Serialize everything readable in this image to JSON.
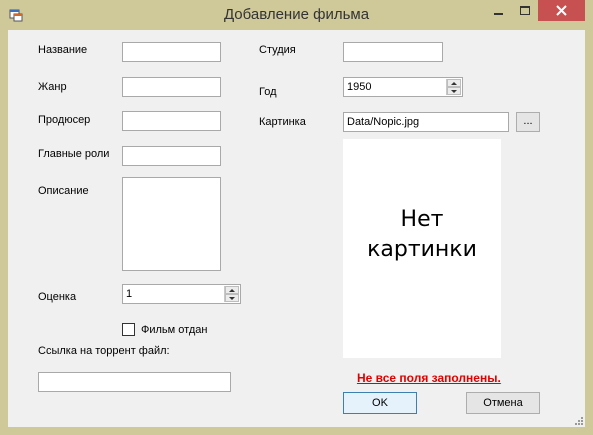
{
  "window": {
    "title": "Добавление фильма",
    "app_icon": "form-icon",
    "controls": [
      "minimize-icon",
      "maximize-icon",
      "close-icon"
    ]
  },
  "labels": {
    "name": "Название",
    "genre": "Жанр",
    "producer": "Продюсер",
    "main_roles": "Главные роли",
    "description": "Описание",
    "rating": "Оценка",
    "studio": "Студия",
    "year": "Год",
    "picture": "Картинка",
    "torrent_link": "Ссылка на торрент файл:"
  },
  "fields": {
    "name": "",
    "genre": "",
    "producer": "",
    "main_roles": "",
    "description": "",
    "studio": "",
    "torrent_link": "",
    "year": "1950",
    "rating": "1",
    "picture_path": "Data/Nopic.jpg"
  },
  "checkbox": {
    "label": "Фильм отдан",
    "checked": false
  },
  "picture_placeholder": "Нет\nкартинки",
  "browse_button": "...",
  "error_message": "Не все поля заполнены.",
  "buttons": {
    "ok": "OK",
    "cancel": "Отмена"
  },
  "colors": {
    "window_frame": "#cfc99a",
    "client_bg": "#f0f0f0",
    "close_button": "#c75050",
    "error_text": "#e00000",
    "default_button_border": "#3c7fb1"
  }
}
